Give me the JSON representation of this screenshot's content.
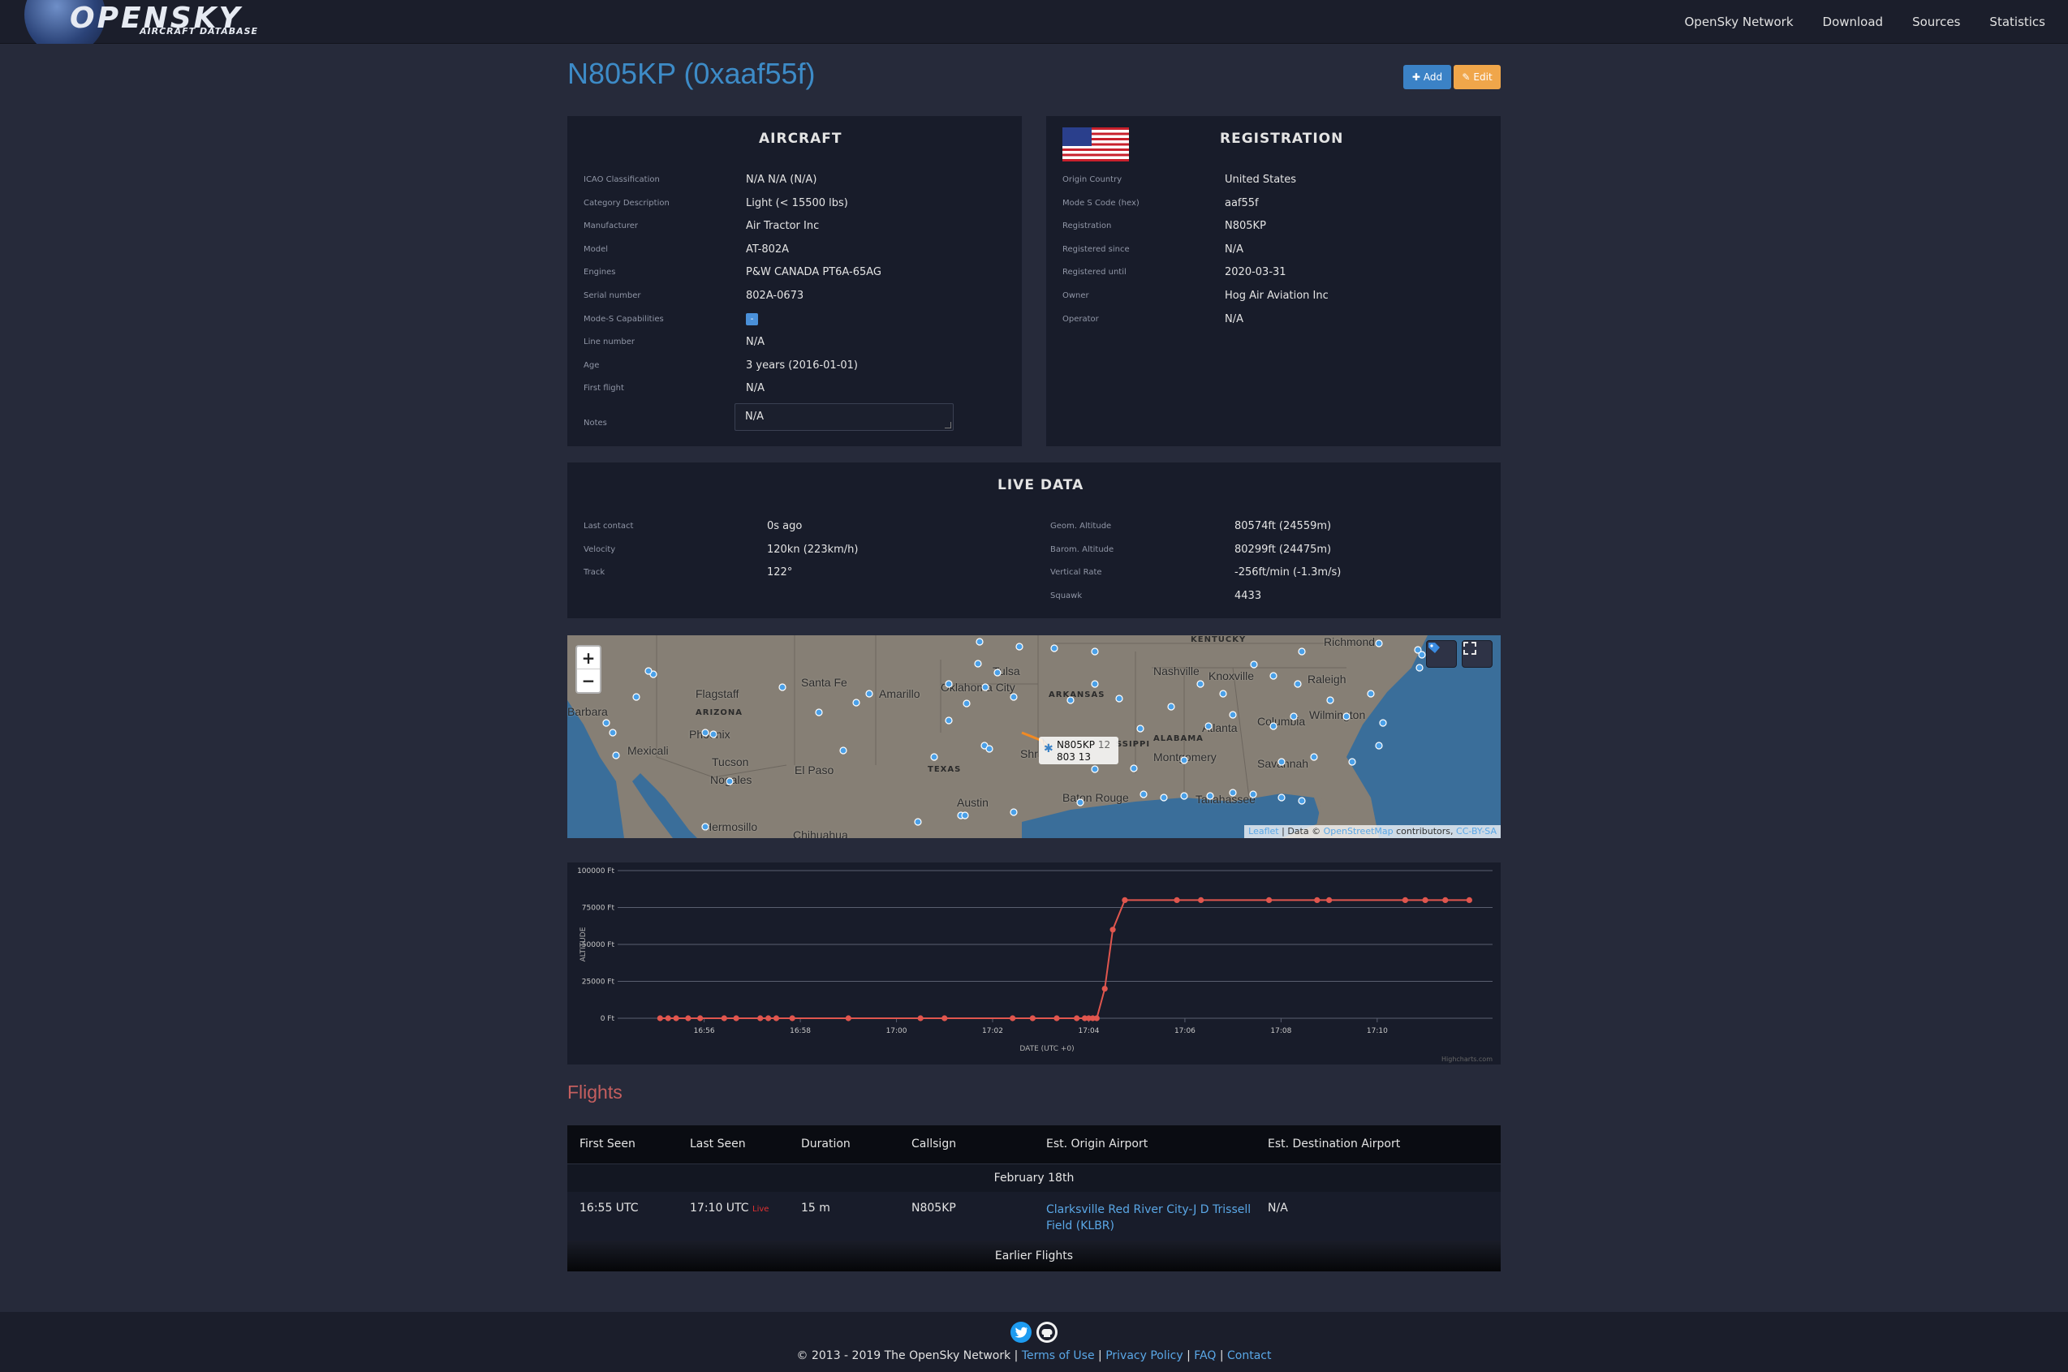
{
  "nav": {
    "logo_text": "OPENSKY",
    "logo_sub": "AIRCRAFT DATABASE",
    "links": [
      "OpenSky Network",
      "Download",
      "Sources",
      "Statistics"
    ]
  },
  "page": {
    "title": "N805KP (0xaaf55f)",
    "add_label": "Add",
    "edit_label": "Edit"
  },
  "aircraft": {
    "title": "AIRCRAFT",
    "fields": [
      {
        "label": "ICAO Classification",
        "value": "N/A N/A (N/A)"
      },
      {
        "label": "Category Description",
        "value": "Light (< 15500 lbs)"
      },
      {
        "label": "Manufacturer",
        "value": "Air Tractor Inc"
      },
      {
        "label": "Model",
        "value": "AT-802A"
      },
      {
        "label": "Engines",
        "value": "P&W CANADA PT6A-65AG"
      },
      {
        "label": "Serial number",
        "value": "802A-0673"
      },
      {
        "label": "Mode-S Capabilities",
        "value": "-"
      },
      {
        "label": "Line number",
        "value": "N/A"
      },
      {
        "label": "Age",
        "value": "3 years (2016-01-01)"
      },
      {
        "label": "First flight",
        "value": "N/A"
      },
      {
        "label": "Notes",
        "value": "N/A"
      }
    ]
  },
  "registration": {
    "title": "REGISTRATION",
    "fields": [
      {
        "label": "Origin Country",
        "value": "United States"
      },
      {
        "label": "Mode S Code (hex)",
        "value": "aaf55f"
      },
      {
        "label": "Registration",
        "value": "N805KP"
      },
      {
        "label": "Registered since",
        "value": "N/A"
      },
      {
        "label": "Registered until",
        "value": "2020-03-31"
      },
      {
        "label": "Owner",
        "value": "Hog Air Aviation Inc"
      },
      {
        "label": "Operator",
        "value": "N/A"
      }
    ]
  },
  "live": {
    "title": "LIVE DATA",
    "left": [
      {
        "label": "Last contact",
        "value": "0s ago"
      },
      {
        "label": "Velocity",
        "value": "120kn (223km/h)"
      },
      {
        "label": "Track",
        "value": "122°"
      }
    ],
    "right": [
      {
        "label": "Geom. Altitude",
        "value": "80574ft (24559m)"
      },
      {
        "label": "Barom. Altitude",
        "value": "80299ft (24475m)"
      },
      {
        "label": "Vertical Rate",
        "value": "-256ft/min (-1.3m/s)"
      },
      {
        "label": "Squawk",
        "value": "4433"
      }
    ]
  },
  "map": {
    "zoom_in": "+",
    "zoom_out": "−",
    "cities": [
      "Flagstaff",
      "Santa Fe",
      "Amarillo",
      "Oklahoma City",
      "Tulsa",
      "Nashville",
      "Knoxville",
      "Richmond",
      "Raleigh",
      "Barbara",
      "Phoenix",
      "Mexicali",
      "Tucson",
      "Nogales",
      "El Paso",
      "Atlanta",
      "Columbia",
      "Wilmington",
      "Montgomery",
      "Savannah",
      "Austin",
      "Baton Rouge",
      "Tallahassee",
      "Hermosillo",
      "Chihuahua",
      "Shr"
    ],
    "states": [
      "KENTUCKY",
      "ARKANSAS",
      "ARIZONA",
      "TEXAS",
      "ALABAMA",
      "SSIPPI"
    ],
    "tooltip_line1": "N805KP",
    "tooltip_line2": "803",
    "tooltip_extra1": "12",
    "tooltip_extra2": "13",
    "attrib_leaflet": "Leaflet",
    "attrib_mid": " | Data © ",
    "attrib_osm": "OpenStreetMap",
    "attrib_contrib": " contributors, ",
    "attrib_license": "CC-BY-SA"
  },
  "chart_data": {
    "type": "line",
    "ylabel": "ALTITUDE",
    "xlabel": "DATE (UTC +0)",
    "credit": "Highcharts.com",
    "y_ticks": [
      "0 Ft",
      "25000 Ft",
      "50000 Ft",
      "75000 Ft",
      "100000 Ft"
    ],
    "x_ticks": [
      "16:56",
      "16:58",
      "17:00",
      "17:02",
      "17:04",
      "17:06",
      "17:08",
      "17:10"
    ],
    "ylim": [
      0,
      100000
    ],
    "xlim_minutes": [
      16.0,
      17.25
    ],
    "series": [
      {
        "x": [
          "16:55:05",
          "16:55:15",
          "16:55:25",
          "16:55:40",
          "16:55:55",
          "16:56:25",
          "16:56:40",
          "16:57:10",
          "16:57:20",
          "16:57:30",
          "16:57:50",
          "16:59:00",
          "17:00:30",
          "17:01:00",
          "17:02:25",
          "17:02:50",
          "17:03:20",
          "17:03:45",
          "17:03:55",
          "17:04:00",
          "17:04:05",
          "17:04:10",
          "17:04:20",
          "17:04:30",
          "17:04:45",
          "17:05:50",
          "17:06:20",
          "17:07:45",
          "17:08:45",
          "17:09:00",
          "17:10:35",
          "17:11:00",
          "17:11:25",
          "17:11:55"
        ],
        "y": [
          0,
          0,
          0,
          0,
          0,
          0,
          0,
          0,
          0,
          0,
          0,
          0,
          0,
          0,
          0,
          0,
          0,
          0,
          0,
          0,
          0,
          0,
          20000,
          60000,
          80000,
          80000,
          80000,
          80000,
          80000,
          80000,
          80000,
          80000,
          80000,
          80000
        ]
      }
    ]
  },
  "flights": {
    "title": "Flights",
    "headers": [
      "First Seen",
      "Last Seen",
      "Duration",
      "Callsign",
      "Est. Origin Airport",
      "Est. Destination Airport"
    ],
    "date_group": "February 18th",
    "rows": [
      {
        "first_seen": "16:55 UTC",
        "last_seen": "17:10 UTC",
        "live": "Live",
        "duration": "15 m",
        "callsign": "N805KP",
        "origin": "Clarksville Red River City-J D Trissell Field (KLBR)",
        "destination": "N/A"
      }
    ],
    "earlier": "Earlier Flights"
  },
  "footer": {
    "copyright": "© 2013 - 2019 The OpenSky Network | ",
    "links": [
      "Terms of Use",
      "Privacy Policy",
      "FAQ",
      "Contact"
    ],
    "sep": " | "
  }
}
